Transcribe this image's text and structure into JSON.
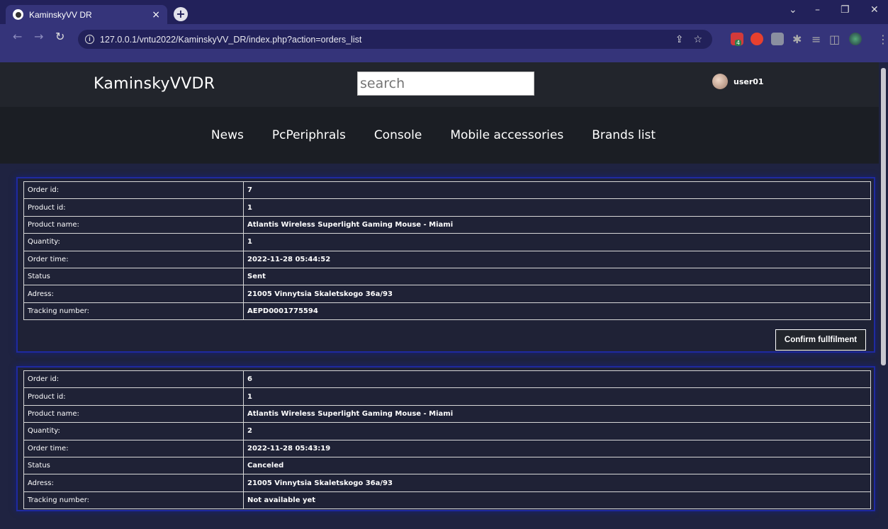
{
  "browser": {
    "tab_title": "KaminskyVV DR",
    "tab_close": "×",
    "new_tab": "+",
    "url": "127.0.0.1/vntu2022/KaminskyVV_DR/index.php?action=orders_list",
    "ext_badge": "4"
  },
  "site": {
    "logo": "KaminskyVVDR",
    "search_placeholder": "search",
    "username": "user01",
    "nav": [
      "News",
      "PcPeriphrals",
      "Console",
      "Mobile accessories",
      "Brands list"
    ]
  },
  "orders": [
    {
      "rows": [
        {
          "label": "Order id:",
          "value": "7"
        },
        {
          "label": "Product id:",
          "value": "1"
        },
        {
          "label": "Product name:",
          "value": "Atlantis Wireless Superlight Gaming Mouse - Miami"
        },
        {
          "label": "Quantity:",
          "value": "1"
        },
        {
          "label": "Order time:",
          "value": "2022-11-28 05:44:52"
        },
        {
          "label": "Status",
          "value": "Sent"
        },
        {
          "label": "Adress:",
          "value": "21005 Vinnytsia Skaletskogo 36a/93"
        },
        {
          "label": "Tracking number:",
          "value": "AEPD0001775594"
        }
      ],
      "confirm_label": "Confirm fullfilment"
    },
    {
      "rows": [
        {
          "label": "Order id:",
          "value": "6"
        },
        {
          "label": "Product id:",
          "value": "1"
        },
        {
          "label": "Product name:",
          "value": "Atlantis Wireless Superlight Gaming Mouse - Miami"
        },
        {
          "label": "Quantity:",
          "value": "2"
        },
        {
          "label": "Order time:",
          "value": "2022-11-28 05:43:19"
        },
        {
          "label": "Status",
          "value": "Canceled"
        },
        {
          "label": "Adress:",
          "value": "21005 Vinnytsia Skaletskogo 36a/93"
        },
        {
          "label": "Tracking number:",
          "value": "Not available yet"
        }
      ]
    }
  ]
}
